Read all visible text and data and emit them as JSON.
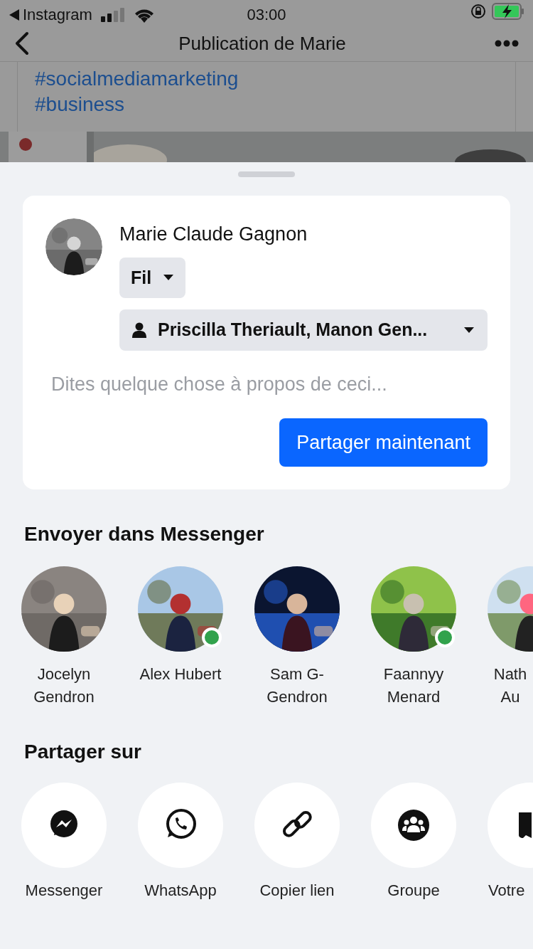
{
  "status_bar": {
    "back_app": "Instagram",
    "time": "03:00"
  },
  "header": {
    "title": "Publication de Marie"
  },
  "post": {
    "hashtags": [
      "#socialmediamarketing",
      "#business"
    ]
  },
  "composer": {
    "author": "Marie Claude Gagnon",
    "destination": "Fil",
    "audience": "Priscilla Theriault, Manon Gen...",
    "message": {
      "placeholder": "Dites quelque chose à propos de ceci..."
    },
    "submit": "Partager maintenant"
  },
  "messenger": {
    "title": "Envoyer dans Messenger",
    "contacts": [
      {
        "name": "Jocelyn Gendron",
        "online": false
      },
      {
        "name": "Alex Hubert",
        "online": true
      },
      {
        "name": "Sam G-Gendron",
        "online": false
      },
      {
        "name": "Faannyy Menard",
        "online": true
      },
      {
        "name": "Nath Au",
        "online": false
      }
    ]
  },
  "share": {
    "title": "Partager sur",
    "targets": [
      {
        "kind": "messenger",
        "label": "Messenger"
      },
      {
        "kind": "whatsapp",
        "label": "WhatsApp"
      },
      {
        "kind": "link",
        "label": "Copier lien"
      },
      {
        "kind": "group",
        "label": "Groupe"
      },
      {
        "kind": "story",
        "label": "Votre"
      }
    ]
  }
}
